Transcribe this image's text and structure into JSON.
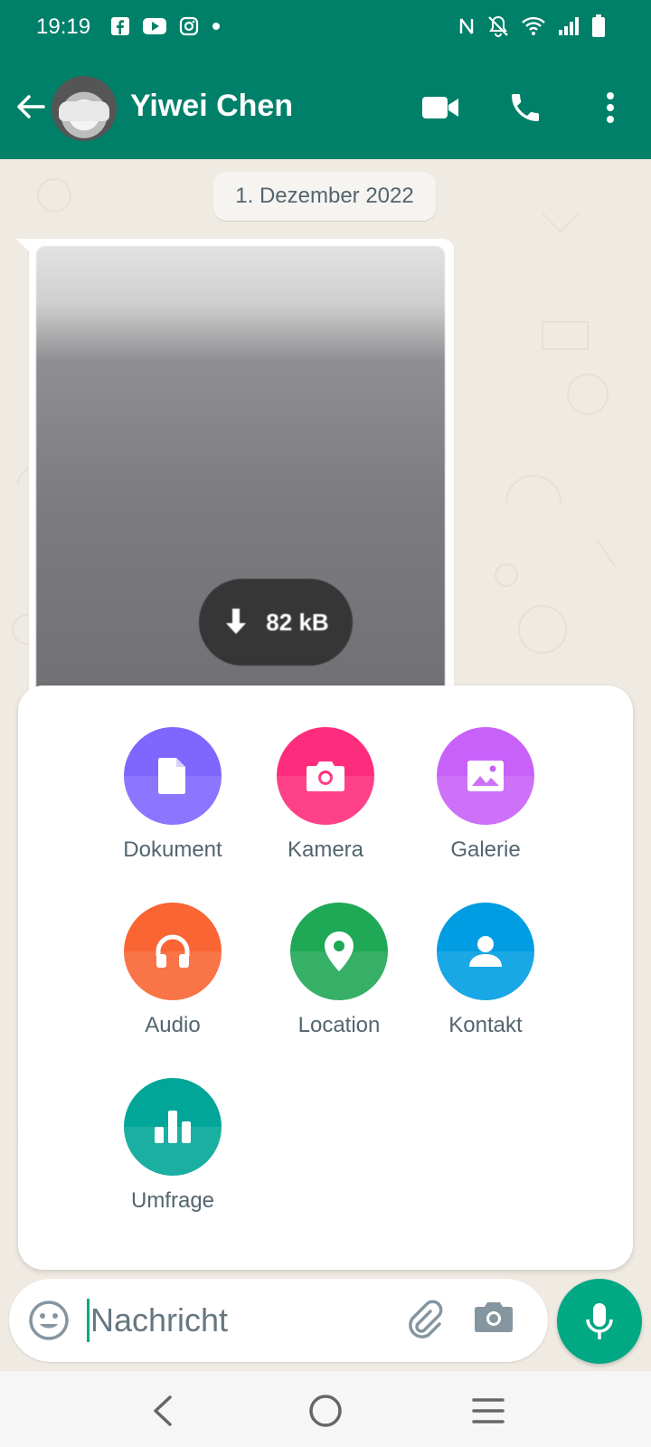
{
  "status_bar": {
    "time": "19:19",
    "app_icons": [
      "facebook-icon",
      "youtube-icon",
      "instagram-icon",
      "dot-icon"
    ],
    "right_icons": [
      "nfc-icon",
      "mute-icon",
      "wifi-icon",
      "signal-icon",
      "battery-icon"
    ]
  },
  "header": {
    "contact_name": "Yiwei Chen",
    "icons": [
      "back-arrow-icon",
      "avatar",
      "video-call-icon",
      "phone-icon",
      "more-vert-icon"
    ]
  },
  "chat": {
    "date_chip": "1. Dezember 2022",
    "media_message": {
      "download_size": "82 kB",
      "icon": "download-icon"
    }
  },
  "attach_menu": {
    "items": [
      {
        "label": "Dokument",
        "icon": "document-icon",
        "color": "#7f66ff"
      },
      {
        "label": "Kamera",
        "icon": "camera-icon",
        "color": "#fe2c7c"
      },
      {
        "label": "Galerie",
        "icon": "gallery-icon",
        "color": "#c861f9"
      },
      {
        "label": "Audio",
        "icon": "headphones-icon",
        "color": "#f96533"
      },
      {
        "label": "Location",
        "icon": "location-pin-icon",
        "color": "#1fa855"
      },
      {
        "label": "Kontakt",
        "icon": "contact-icon",
        "color": "#009de2"
      },
      {
        "label": "Umfrage",
        "icon": "poll-icon",
        "color": "#02a698"
      }
    ]
  },
  "input": {
    "placeholder": "Nachricht",
    "icons": [
      "emoji-icon",
      "paperclip-icon",
      "camera-icon",
      "mic-icon"
    ]
  },
  "colors": {
    "header": "#008069",
    "accent": "#00a884",
    "chat_bg": "#efeae2"
  },
  "nav_bar": {
    "icons": [
      "back-chevron-icon",
      "home-circle-icon",
      "menu-lines-icon"
    ]
  }
}
